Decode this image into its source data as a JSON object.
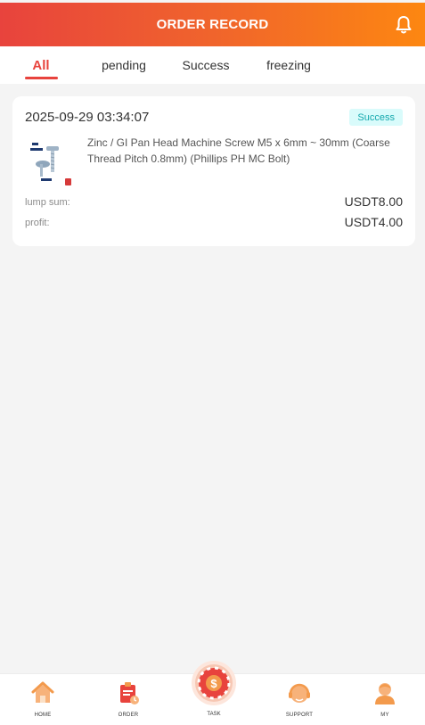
{
  "header": {
    "title": "ORDER RECORD",
    "bell_icon": "bell-icon"
  },
  "tabs": [
    {
      "label": "All",
      "active": true
    },
    {
      "label": "pending",
      "active": false
    },
    {
      "label": "Success",
      "active": false
    },
    {
      "label": "freezing",
      "active": false
    }
  ],
  "orders": [
    {
      "time": "2025-09-29 03:34:07",
      "status": "Success",
      "product_name": "Zinc / GI Pan Head Machine Screw M5 x 6mm ~ 30mm (Coarse Thread Pitch 0.8mm) (Phillips PH MC Bolt)",
      "lump_sum_label": "lump sum:",
      "lump_sum_value": "USDT8.00",
      "profit_label": "profit:",
      "profit_value": "USDT4.00"
    }
  ],
  "bottom_nav": [
    {
      "label": "HOME",
      "icon": "home-icon"
    },
    {
      "label": "ORDER",
      "icon": "order-icon"
    },
    {
      "label": "TASK",
      "icon": "task-icon"
    },
    {
      "label": "SUPPORT",
      "icon": "support-icon"
    },
    {
      "label": "MY",
      "icon": "user-icon"
    }
  ],
  "colors": {
    "accent": "#e8433d",
    "header_gradient_start": "#e8433d",
    "header_gradient_end": "#fd8711",
    "success_badge_bg": "#d9fbfb",
    "success_badge_text": "#14a8ad"
  }
}
